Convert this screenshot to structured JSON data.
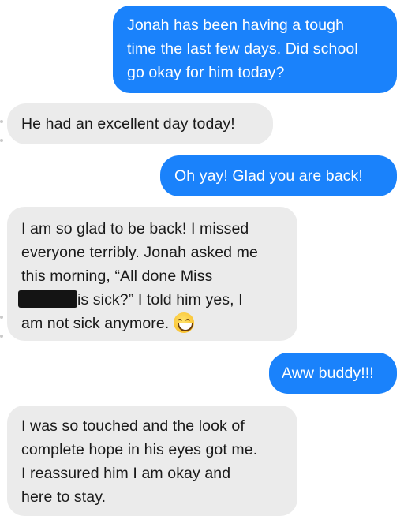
{
  "messages": [
    {
      "direction": "outgoing",
      "lines": [
        "Jonah has been having a tough",
        "time the last few days. Did school",
        "go okay for him today?"
      ]
    },
    {
      "direction": "incoming",
      "lines": [
        "He had an excellent day today!"
      ]
    },
    {
      "direction": "outgoing",
      "lines": [
        "Oh yay! Glad you are back!"
      ]
    },
    {
      "direction": "incoming",
      "lines": [
        "I am so glad to be back! I missed",
        "everyone terribly. Jonah asked me",
        "this morning, “All done Miss",
        "is sick?” I told him yes, I",
        "am not sick anymore."
      ]
    },
    {
      "direction": "outgoing",
      "lines": [
        "Aww buddy!!!"
      ]
    },
    {
      "direction": "incoming",
      "lines": [
        "I was so touched and the look of",
        "complete hope in his eyes got me.",
        "I reassured him I am okay and",
        "here to stay."
      ]
    }
  ],
  "emoji": "grinning-face-with-smiling-eyes",
  "colors": {
    "outgoing": "#1a82fb",
    "incoming": "#ebebeb",
    "incoming_text": "#1a1a1a"
  }
}
